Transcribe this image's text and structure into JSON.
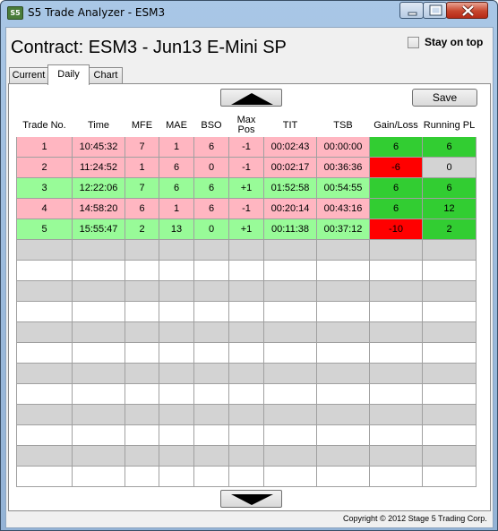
{
  "window": {
    "title": "S5 Trade Analyzer - ESM3",
    "icon": "app-icon",
    "icon_text": "S5"
  },
  "header": {
    "contract_title": "Contract: ESM3 - Jun13 E-Mini SP",
    "stay_on_top_label": "Stay on top",
    "stay_on_top_checked": false
  },
  "tabs": [
    {
      "label": "Current",
      "active": false
    },
    {
      "label": "Daily",
      "active": true
    },
    {
      "label": "Chart",
      "active": false
    }
  ],
  "toolbar": {
    "save_label": "Save",
    "scroll_up_icon": "triangle-up-icon",
    "scroll_down_icon": "triangle-down-icon"
  },
  "table": {
    "columns": [
      "Trade No.",
      "Time",
      "MFE",
      "MAE",
      "BSO",
      "Max Pos",
      "TIT",
      "TSB",
      "Gain/Loss",
      "Running PL"
    ],
    "rows": [
      {
        "trade_no": "1",
        "time": "10:45:32",
        "mfe": "7",
        "mae": "1",
        "bso": "6",
        "max_pos": "-1",
        "tit": "00:02:43",
        "tsb": "00:00:00",
        "gain_loss": "6",
        "running_pl": "6"
      },
      {
        "trade_no": "2",
        "time": "11:24:52",
        "mfe": "1",
        "mae": "6",
        "bso": "0",
        "max_pos": "-1",
        "tit": "00:02:17",
        "tsb": "00:36:36",
        "gain_loss": "-6",
        "running_pl": "0"
      },
      {
        "trade_no": "3",
        "time": "12:22:06",
        "mfe": "7",
        "mae": "6",
        "bso": "6",
        "max_pos": "+1",
        "tit": "01:52:58",
        "tsb": "00:54:55",
        "gain_loss": "6",
        "running_pl": "6"
      },
      {
        "trade_no": "4",
        "time": "14:58:20",
        "mfe": "6",
        "mae": "1",
        "bso": "6",
        "max_pos": "-1",
        "tit": "00:20:14",
        "tsb": "00:43:16",
        "gain_loss": "6",
        "running_pl": "12"
      },
      {
        "trade_no": "5",
        "time": "15:55:47",
        "mfe": "2",
        "mae": "13",
        "bso": "0",
        "max_pos": "+1",
        "tit": "00:11:38",
        "tsb": "00:37:12",
        "gain_loss": "-10",
        "running_pl": "2"
      }
    ],
    "row_colors": {
      "short": "#ffb6c1",
      "long": "#98fb98",
      "empty_alt": "#d3d3d3"
    },
    "cell_colors": {
      "gain": "#32cd32",
      "loss": "#ff0000",
      "flat": "#d3d3d3"
    }
  },
  "footer": {
    "copyright": "Copyright © 2012 Stage 5 Trading Corp."
  }
}
